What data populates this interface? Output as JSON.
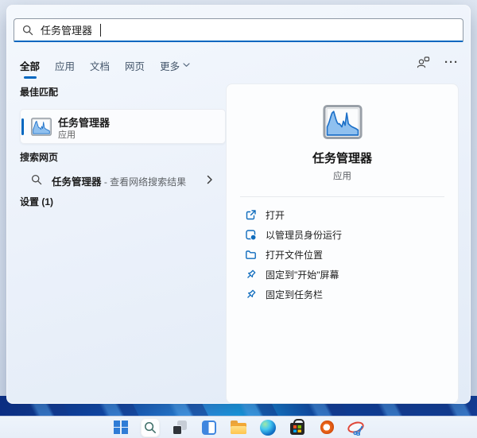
{
  "search_box": {
    "value": "任务管理器"
  },
  "tabs": {
    "items": [
      {
        "label": "全部",
        "active": true
      },
      {
        "label": "应用",
        "active": false
      },
      {
        "label": "文档",
        "active": false
      },
      {
        "label": "网页",
        "active": false
      },
      {
        "label": "更多",
        "active": false,
        "has_chevron": true
      }
    ],
    "ellipsis": "···"
  },
  "left_pane": {
    "best_match_heading": "最佳匹配",
    "best_match": {
      "title": "任务管理器",
      "subtitle": "应用",
      "icon": "task-manager-chart-icon"
    },
    "web_heading": "搜索网页",
    "web_row": {
      "query": "任务管理器",
      "suffix": " - 查看网络搜索结果"
    },
    "settings_heading": "设置 (1)"
  },
  "right_pane": {
    "title": "任务管理器",
    "subtitle": "应用",
    "icon": "task-manager-chart-icon",
    "actions": [
      {
        "label": "打开",
        "icon": "open-icon"
      },
      {
        "label": "以管理员身份运行",
        "icon": "run-as-admin-icon"
      },
      {
        "label": "打开文件位置",
        "icon": "folder-icon"
      },
      {
        "label": "固定到\"开始\"屏幕",
        "icon": "pin-icon"
      },
      {
        "label": "固定到任务栏",
        "icon": "pin-icon"
      }
    ]
  },
  "taskbar": {
    "icons": [
      "windows-start-icon",
      "search-icon",
      "task-view-icon",
      "widgets-icon",
      "file-explorer-icon",
      "edge-icon",
      "microsoft-store-icon",
      "office-icon",
      "snipping-tool-icon"
    ],
    "active_icon": "search-icon"
  },
  "colors": {
    "accent": "#0067c0",
    "action_icon_blue": "#0f6cbd",
    "chart_line": "#1d70c8",
    "chart_fill": "#8fc0ef",
    "taskbar_bg": "#ecf3fb",
    "wallpaper_blue": "#0f4aad"
  }
}
